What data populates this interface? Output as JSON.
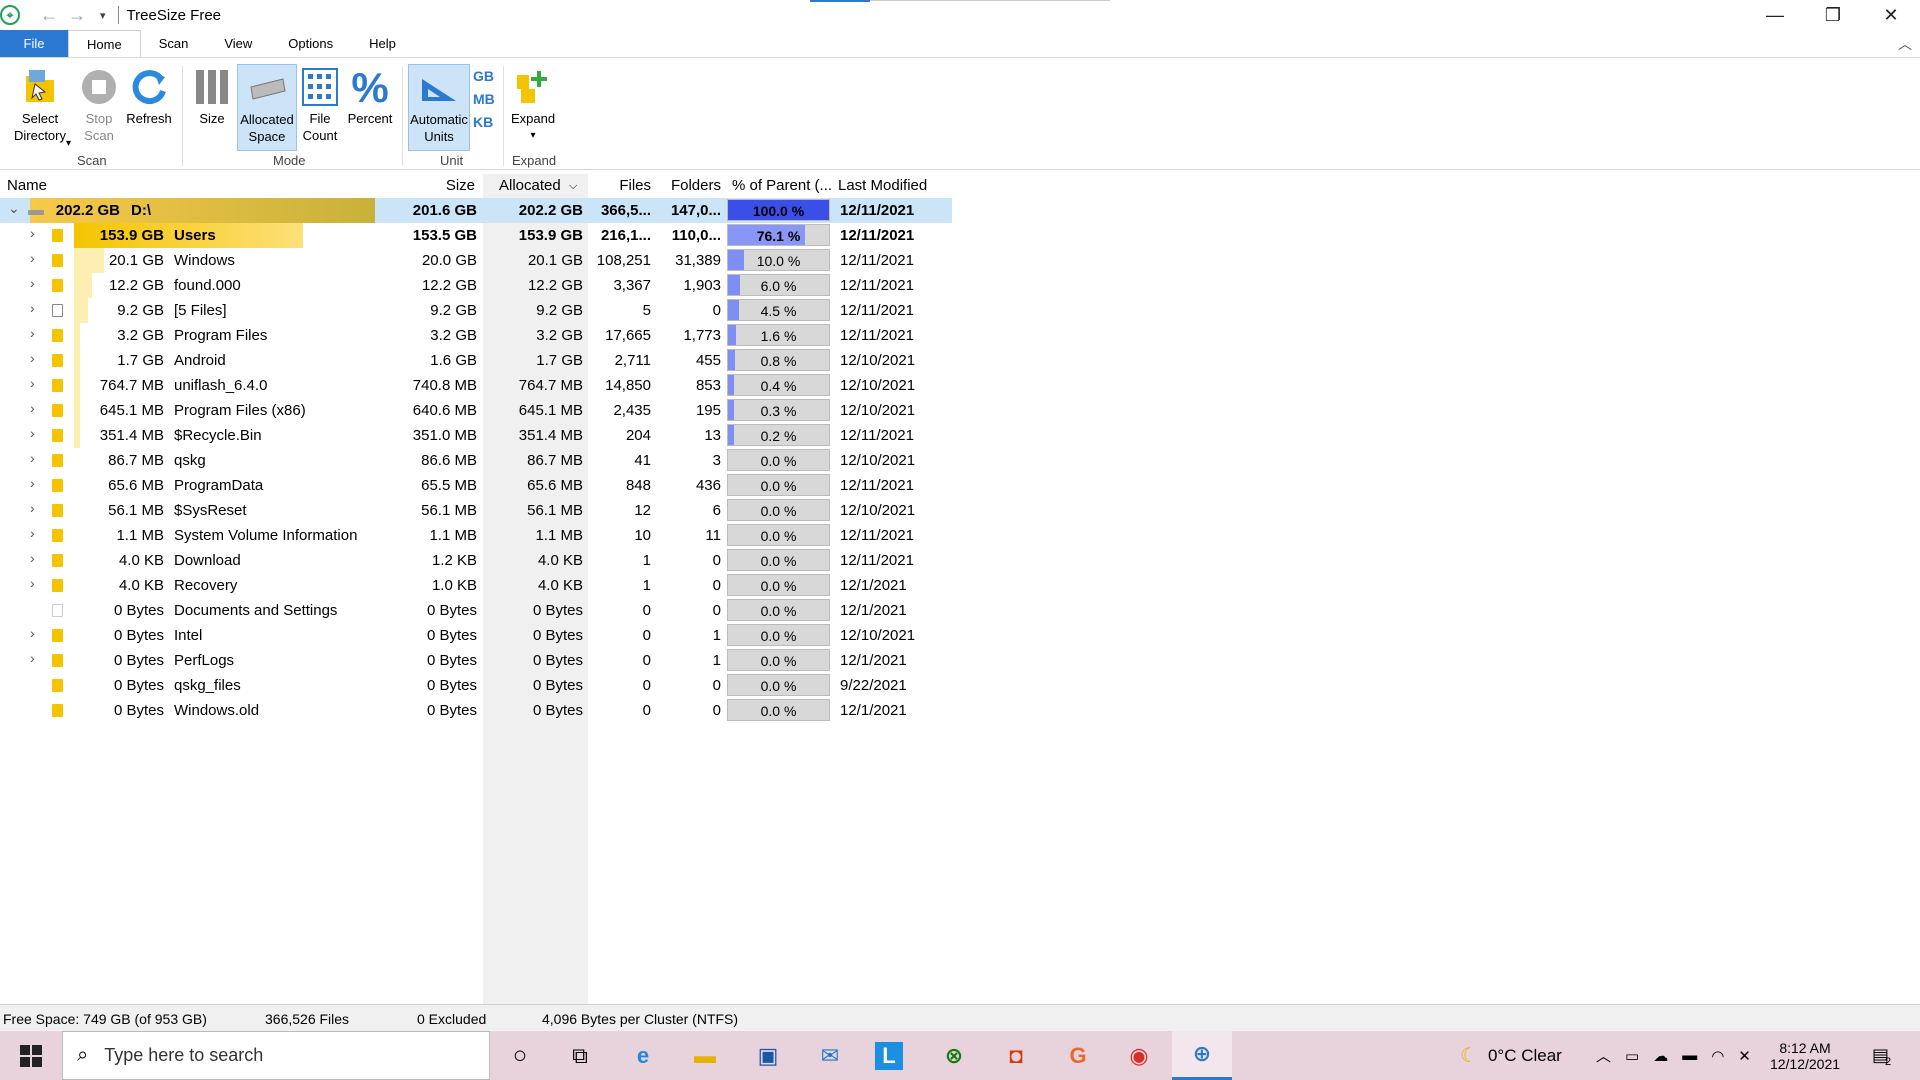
{
  "window": {
    "title": "TreeSize Free"
  },
  "tabs": [
    "File",
    "Home",
    "Scan",
    "View",
    "Options",
    "Help"
  ],
  "ribbon": {
    "select_directory": "Select\nDirectory",
    "stop_scan": "Stop\nScan",
    "refresh": "Refresh",
    "size": "Size",
    "allocated_space": "Allocated\nSpace",
    "file_count": "File\nCount",
    "percent": "Percent",
    "automatic_units": "Automatic\nUnits",
    "unit_gb": "GB",
    "unit_mb": "MB",
    "unit_kb": "KB",
    "expand": "Expand",
    "groups": {
      "scan": "Scan",
      "mode": "Mode",
      "unit": "Unit",
      "expand": "Expand"
    }
  },
  "columns": {
    "name": "Name",
    "size": "Size",
    "allocated": "Allocated",
    "files": "Files",
    "folders": "Folders",
    "percent_parent": "% of Parent (...",
    "last_modified": "Last Modified"
  },
  "rows": [
    {
      "sizeLabel": "202.2 GB",
      "name": "D:\\",
      "size": "201.6 GB",
      "alloc": "202.2 GB",
      "files": "366,5...",
      "folders": "147,0...",
      "pct": "100.0 %",
      "pctVal": 100,
      "mod": "12/11/2021",
      "icon": "drive",
      "expand": "down",
      "bold": true,
      "sel": true,
      "bar": 1.0
    },
    {
      "sizeLabel": "153.9 GB",
      "name": "Users",
      "size": "153.5 GB",
      "alloc": "153.9 GB",
      "files": "216,1...",
      "folders": "110,0...",
      "pct": "76.1 %",
      "pctVal": 76.1,
      "mod": "12/11/2021",
      "icon": "folder",
      "expand": "right",
      "bold": true,
      "bar": 0.761
    },
    {
      "sizeLabel": "20.1 GB",
      "name": "Windows",
      "size": "20.0 GB",
      "alloc": "20.1 GB",
      "files": "108,251",
      "folders": "31,389",
      "pct": "10.0 %",
      "pctVal": 10,
      "mod": "12/11/2021",
      "icon": "folder",
      "expand": "right",
      "bar": 0.1
    },
    {
      "sizeLabel": "12.2 GB",
      "name": "found.000",
      "size": "12.2 GB",
      "alloc": "12.2 GB",
      "files": "3,367",
      "folders": "1,903",
      "pct": "6.0 %",
      "pctVal": 6,
      "mod": "12/11/2021",
      "icon": "folder",
      "expand": "right",
      "bar": 0.06
    },
    {
      "sizeLabel": "9.2 GB",
      "name": "[5 Files]",
      "size": "9.2 GB",
      "alloc": "9.2 GB",
      "files": "5",
      "folders": "0",
      "pct": "4.5 %",
      "pctVal": 4.5,
      "mod": "12/11/2021",
      "icon": "file",
      "expand": "right",
      "bar": 0.045
    },
    {
      "sizeLabel": "3.2 GB",
      "name": "Program Files",
      "size": "3.2 GB",
      "alloc": "3.2 GB",
      "files": "17,665",
      "folders": "1,773",
      "pct": "1.6 %",
      "pctVal": 1.6,
      "mod": "12/11/2021",
      "icon": "folder",
      "expand": "right",
      "bar": 0.016
    },
    {
      "sizeLabel": "1.7 GB",
      "name": "Android",
      "size": "1.6 GB",
      "alloc": "1.7 GB",
      "files": "2,711",
      "folders": "455",
      "pct": "0.8 %",
      "pctVal": 0.8,
      "mod": "12/10/2021",
      "icon": "folder",
      "expand": "right",
      "bar": 0.008
    },
    {
      "sizeLabel": "764.7 MB",
      "name": "uniflash_6.4.0",
      "size": "740.8 MB",
      "alloc": "764.7 MB",
      "files": "14,850",
      "folders": "853",
      "pct": "0.4 %",
      "pctVal": 0.4,
      "mod": "12/10/2021",
      "icon": "folder",
      "expand": "right",
      "bar": 0.004
    },
    {
      "sizeLabel": "645.1 MB",
      "name": "Program Files (x86)",
      "size": "640.6 MB",
      "alloc": "645.1 MB",
      "files": "2,435",
      "folders": "195",
      "pct": "0.3 %",
      "pctVal": 0.3,
      "mod": "12/10/2021",
      "icon": "folder",
      "expand": "right",
      "bar": 0.003
    },
    {
      "sizeLabel": "351.4 MB",
      "name": "$Recycle.Bin",
      "size": "351.0 MB",
      "alloc": "351.4 MB",
      "files": "204",
      "folders": "13",
      "pct": "0.2 %",
      "pctVal": 0.2,
      "mod": "12/11/2021",
      "icon": "folder",
      "expand": "right",
      "bar": 0.002
    },
    {
      "sizeLabel": "86.7 MB",
      "name": "qskg",
      "size": "86.6 MB",
      "alloc": "86.7 MB",
      "files": "41",
      "folders": "3",
      "pct": "0.0 %",
      "pctVal": 0,
      "mod": "12/10/2021",
      "icon": "folder",
      "expand": "right",
      "bar": 0
    },
    {
      "sizeLabel": "65.6 MB",
      "name": "ProgramData",
      "size": "65.5 MB",
      "alloc": "65.6 MB",
      "files": "848",
      "folders": "436",
      "pct": "0.0 %",
      "pctVal": 0,
      "mod": "12/11/2021",
      "icon": "folder",
      "expand": "right",
      "bar": 0
    },
    {
      "sizeLabel": "56.1 MB",
      "name": "$SysReset",
      "size": "56.1 MB",
      "alloc": "56.1 MB",
      "files": "12",
      "folders": "6",
      "pct": "0.0 %",
      "pctVal": 0,
      "mod": "12/10/2021",
      "icon": "folder",
      "expand": "right",
      "bar": 0
    },
    {
      "sizeLabel": "1.1 MB",
      "name": "System Volume Information",
      "size": "1.1 MB",
      "alloc": "1.1 MB",
      "files": "10",
      "folders": "11",
      "pct": "0.0 %",
      "pctVal": 0,
      "mod": "12/11/2021",
      "icon": "folder",
      "expand": "right",
      "bar": 0
    },
    {
      "sizeLabel": "4.0 KB",
      "name": "Download",
      "size": "1.2 KB",
      "alloc": "4.0 KB",
      "files": "1",
      "folders": "0",
      "pct": "0.0 %",
      "pctVal": 0,
      "mod": "12/11/2021",
      "icon": "folder",
      "expand": "right",
      "bar": 0
    },
    {
      "sizeLabel": "4.0 KB",
      "name": "Recovery",
      "size": "1.0 KB",
      "alloc": "4.0 KB",
      "files": "1",
      "folders": "0",
      "pct": "0.0 %",
      "pctVal": 0,
      "mod": "12/1/2021",
      "icon": "folder",
      "expand": "right",
      "bar": 0
    },
    {
      "sizeLabel": "0 Bytes",
      "name": "Documents and Settings",
      "size": "0 Bytes",
      "alloc": "0 Bytes",
      "files": "0",
      "folders": "0",
      "pct": "0.0 %",
      "pctVal": 0,
      "mod": "12/1/2021",
      "icon": "link",
      "expand": "none",
      "bar": 0
    },
    {
      "sizeLabel": "0 Bytes",
      "name": "Intel",
      "size": "0 Bytes",
      "alloc": "0 Bytes",
      "files": "0",
      "folders": "1",
      "pct": "0.0 %",
      "pctVal": 0,
      "mod": "12/10/2021",
      "icon": "folder",
      "expand": "right",
      "bar": 0
    },
    {
      "sizeLabel": "0 Bytes",
      "name": "PerfLogs",
      "size": "0 Bytes",
      "alloc": "0 Bytes",
      "files": "0",
      "folders": "1",
      "pct": "0.0 %",
      "pctVal": 0,
      "mod": "12/1/2021",
      "icon": "folder",
      "expand": "right",
      "bar": 0
    },
    {
      "sizeLabel": "0 Bytes",
      "name": "qskg_files",
      "size": "0 Bytes",
      "alloc": "0 Bytes",
      "files": "0",
      "folders": "0",
      "pct": "0.0 %",
      "pctVal": 0,
      "mod": "9/22/2021",
      "icon": "folder",
      "expand": "none",
      "bar": 0
    },
    {
      "sizeLabel": "0 Bytes",
      "name": "Windows.old",
      "size": "0 Bytes",
      "alloc": "0 Bytes",
      "files": "0",
      "folders": "0",
      "pct": "0.0 %",
      "pctVal": 0,
      "mod": "12/1/2021",
      "icon": "folder",
      "expand": "none",
      "bar": 0
    }
  ],
  "status": {
    "free_space": "Free Space: 749 GB  (of 953 GB)",
    "files": "366,526 Files",
    "excluded": "0 Excluded",
    "cluster": "4,096 Bytes per Cluster (NTFS)"
  },
  "taskbar": {
    "search_placeholder": "Type here to search",
    "weather": "0°C  Clear",
    "time": "8:12 AM",
    "date": "12/12/2021",
    "notifications": "2"
  },
  "colors": {
    "accent": "#2b79d0",
    "folder": "#f5c400",
    "selected_row": "#cce4f7",
    "percent_fill": "#7e8ef2"
  }
}
